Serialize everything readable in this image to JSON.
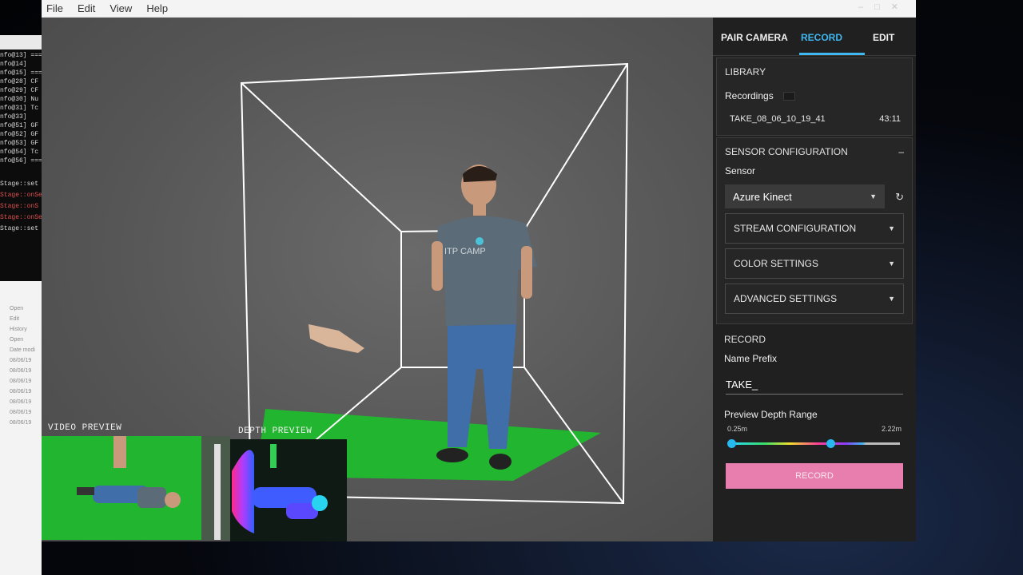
{
  "menu": [
    "File",
    "Edit",
    "View",
    "Help"
  ],
  "tabs": [
    {
      "label": "PAIR CAMERA",
      "active": false
    },
    {
      "label": "RECORD",
      "active": true
    },
    {
      "label": "EDIT",
      "active": false
    }
  ],
  "library": {
    "title": "LIBRARY",
    "recordings_label": "Recordings",
    "items": [
      {
        "name": "TAKE_08_06_10_19_41",
        "duration": "43:11"
      }
    ]
  },
  "sensor_config": {
    "title": "SENSOR CONFIGURATION",
    "collapse_symbol": "–",
    "sensor_label": "Sensor",
    "sensor_value": "Azure Kinect",
    "sections": [
      {
        "label": "STREAM CONFIGURATION"
      },
      {
        "label": "COLOR SETTINGS"
      },
      {
        "label": "ADVANCED SETTINGS"
      }
    ]
  },
  "record": {
    "title": "RECORD",
    "name_prefix_label": "Name Prefix",
    "name_prefix_value": "TAKE_",
    "depth_range_label": "Preview Depth Range",
    "depth_min": "0.25m",
    "depth_max": "2.22m",
    "slider_low_fraction": 0.0,
    "slider_high_fraction": 0.6,
    "button_label": "RECORD"
  },
  "previews": {
    "video_label": "VIDEO PREVIEW",
    "depth_label": "DEPTH PREVIEW"
  },
  "terminal_lines": [
    "nfo@13] ===",
    "nfo@14]",
    "nfo@15] ===",
    "nfo@28]  CF",
    "nfo@29]  CF",
    "nfo@30]  Nu",
    "nfo@31]  Tc",
    "nfo@33]",
    "nfo@51]  GF",
    "nfo@52]  GF",
    "nfo@53]  GF",
    "nfo@54]  Tc",
    "nfo@56] ==="
  ],
  "terminal_stage_lines": [
    "Stage::set",
    "Stage::onSe",
    "Stage::onS",
    "Stage::onSe",
    "Stage::set"
  ],
  "explorer_lines": [
    "Open",
    "Edit",
    "History",
    "Open",
    "Date modi",
    "08/06/19",
    "08/06/19",
    "08/06/19",
    "08/06/19",
    "08/06/19",
    "08/06/19",
    "08/06/19"
  ],
  "colors": {
    "accent": "#3fb7f0",
    "record_button": "#e77eae",
    "green_screen": "#22b52f",
    "panel_bg": "#202020"
  },
  "icons": [
    "folder-icon",
    "chevron-down-icon",
    "refresh-icon",
    "minimize-icon",
    "maximize-icon",
    "close-icon"
  ]
}
